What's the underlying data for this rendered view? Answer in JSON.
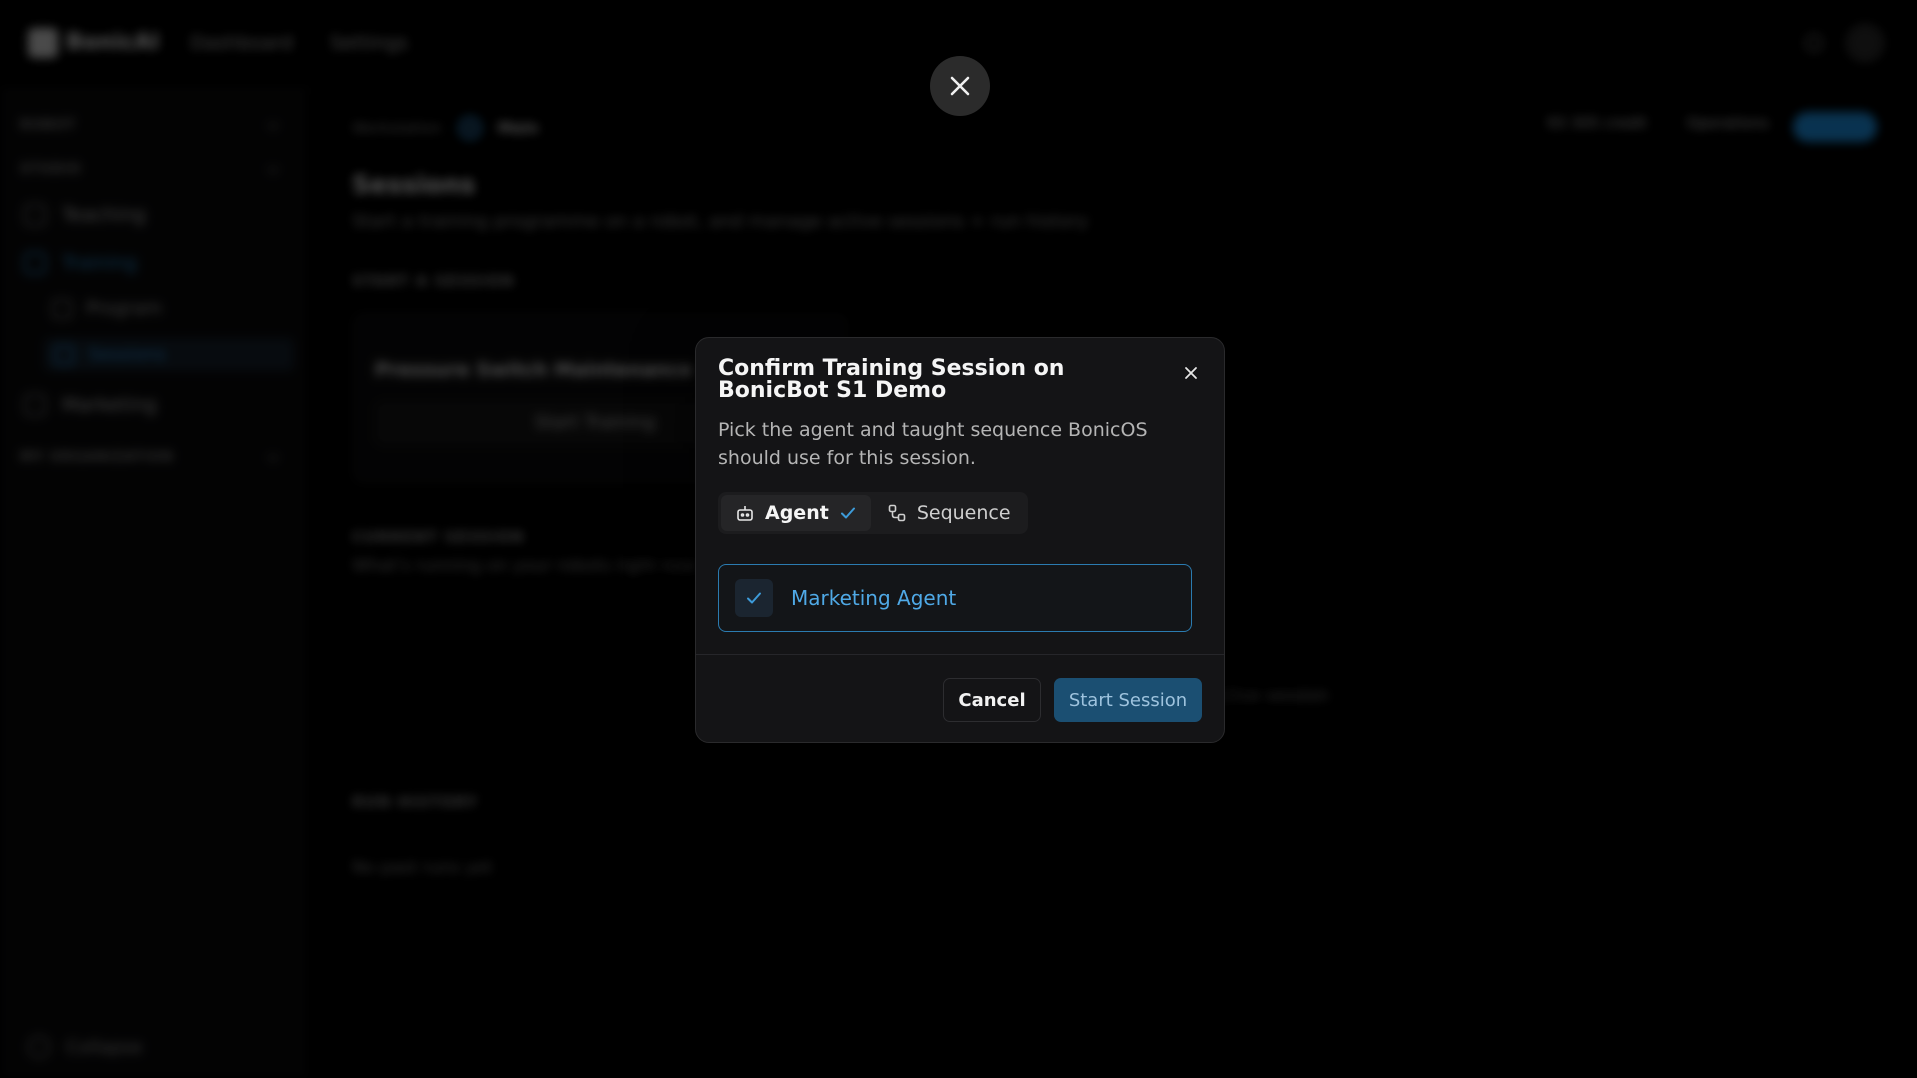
{
  "app": {
    "brand": "BonicAI",
    "nav": [
      "Dashboard",
      "Settings"
    ]
  },
  "sidebar": {
    "sections": [
      "ROBOT",
      "STUDIO",
      "MY ORGANIZATION"
    ],
    "items": [
      {
        "label": "Teaching"
      },
      {
        "label": "Training"
      },
      {
        "label": "Marketing"
      }
    ],
    "subitems": [
      {
        "label": "Program"
      },
      {
        "label": "Sessions"
      }
    ],
    "collapse_label": "Collapse"
  },
  "main": {
    "breadcrumb_root": "Workstation",
    "breadcrumb_current": "Main",
    "header_stat": "93 305 credit",
    "header_link": "Operations",
    "title": "Sessions",
    "subtitle": "Start a training programme on a robot, and manage active sessions + run history",
    "start_label": "START A SESSION",
    "card_title": "Pressure Switch Maintenance",
    "card_button": "Start Training",
    "current_label": "CURRENT SESSION",
    "current_sub": "What's running on your robots right now",
    "empty_hint": "No active session",
    "history_label": "RUN HISTORY",
    "history_empty": "No past runs yet"
  },
  "dialog": {
    "title": "Confirm Training Session on BonicBot S1 Demo",
    "description": "Pick the agent and taught sequence BonicOS should use for this session.",
    "tabs": [
      {
        "label": "Agent",
        "active": true,
        "done": true
      },
      {
        "label": "Sequence",
        "active": false,
        "done": false
      }
    ],
    "selected_agent": "Marketing Agent",
    "cancel_label": "Cancel",
    "start_label": "Start Session"
  },
  "colors": {
    "accent": "#2b7bb0",
    "accent_text": "#4fa9e6",
    "primary_button": "#1b4f72"
  }
}
